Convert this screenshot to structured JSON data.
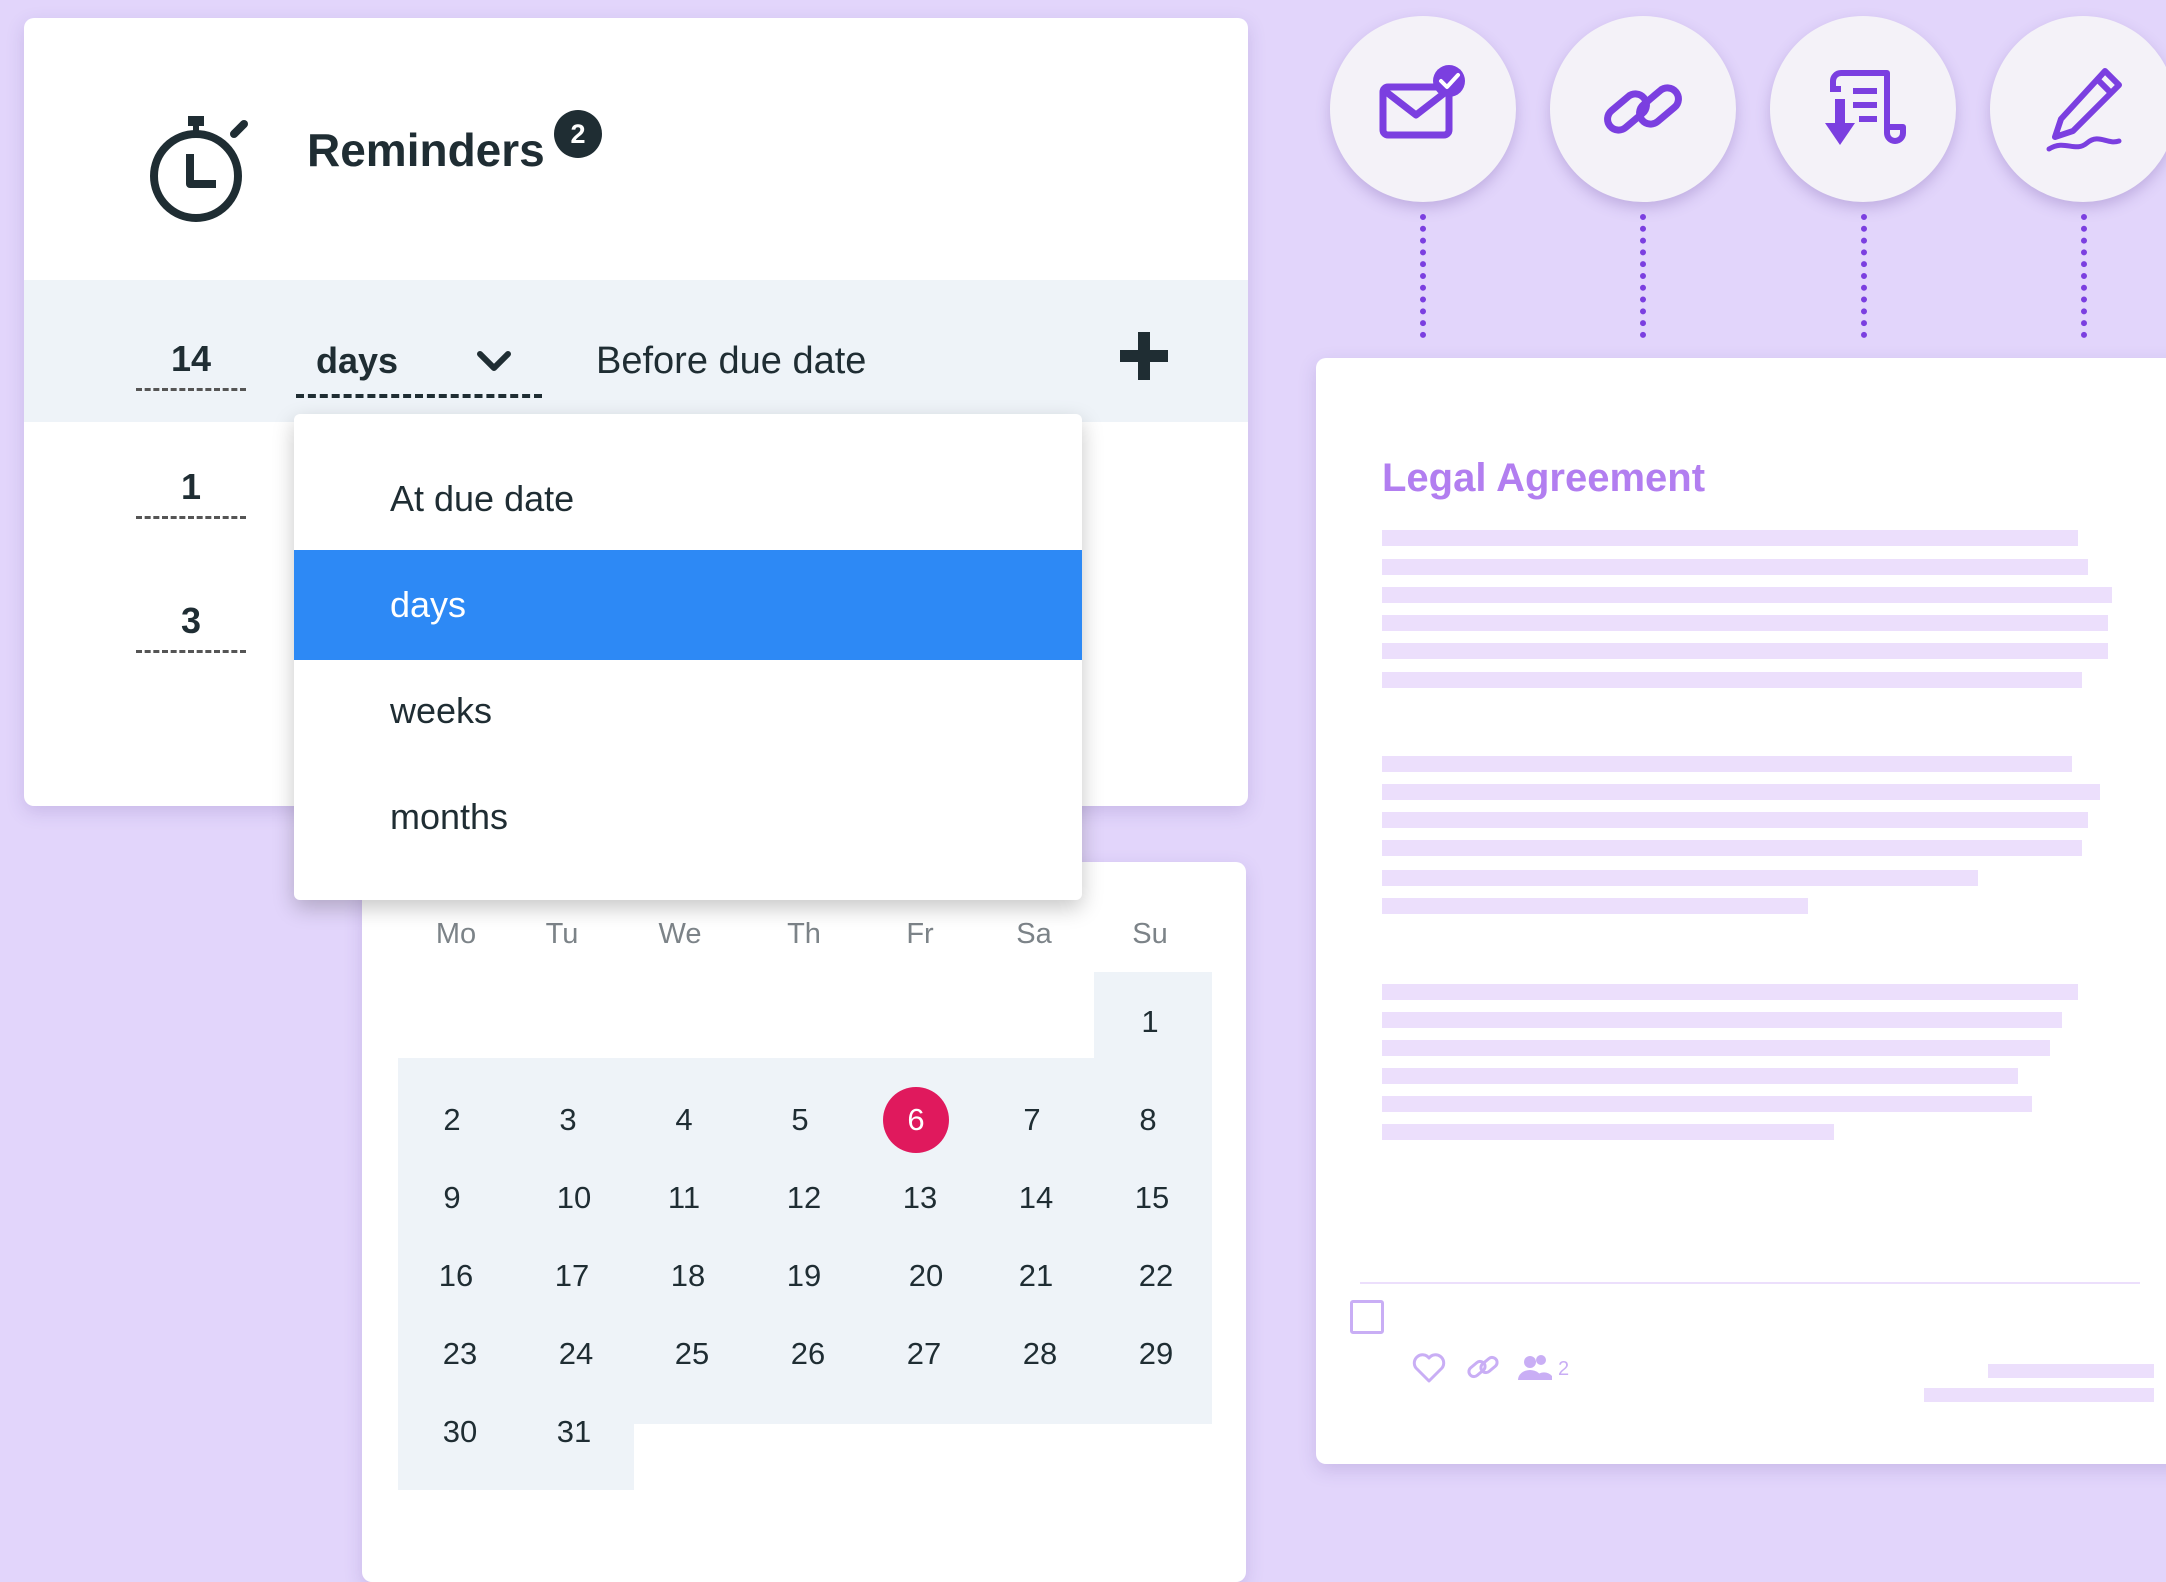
{
  "reminders": {
    "title": "Reminders",
    "badge_count": "2",
    "active_row": {
      "amount": "14",
      "unit": "days",
      "relation": "Before due date"
    },
    "other_amounts": [
      "1",
      "3"
    ]
  },
  "dropdown": {
    "options": [
      "At due date",
      "days",
      "weeks",
      "months"
    ],
    "selected": "days"
  },
  "calendar": {
    "weekdays": [
      "Mo",
      "Tu",
      "We",
      "Th",
      "Fr",
      "Sa",
      "Su"
    ],
    "days": [
      "1",
      "2",
      "3",
      "4",
      "5",
      "6",
      "7",
      "8",
      "9",
      "10",
      "11",
      "12",
      "13",
      "14",
      "15",
      "16",
      "17",
      "18",
      "19",
      "20",
      "21",
      "22",
      "23",
      "24",
      "25",
      "26",
      "27",
      "28",
      "29",
      "30",
      "31"
    ],
    "today": "6"
  },
  "actions": [
    "mail-check-icon",
    "link-icon",
    "document-download-icon",
    "pen-sign-icon"
  ],
  "document": {
    "title": "Legal Agreement",
    "collaborator_count": "2"
  },
  "colors": {
    "background": "#e2d5fb",
    "accent_purple": "#7b3fe0",
    "selected_blue": "#2d89f5",
    "today_red": "#e0195d",
    "doc_title": "#b27ef0"
  }
}
